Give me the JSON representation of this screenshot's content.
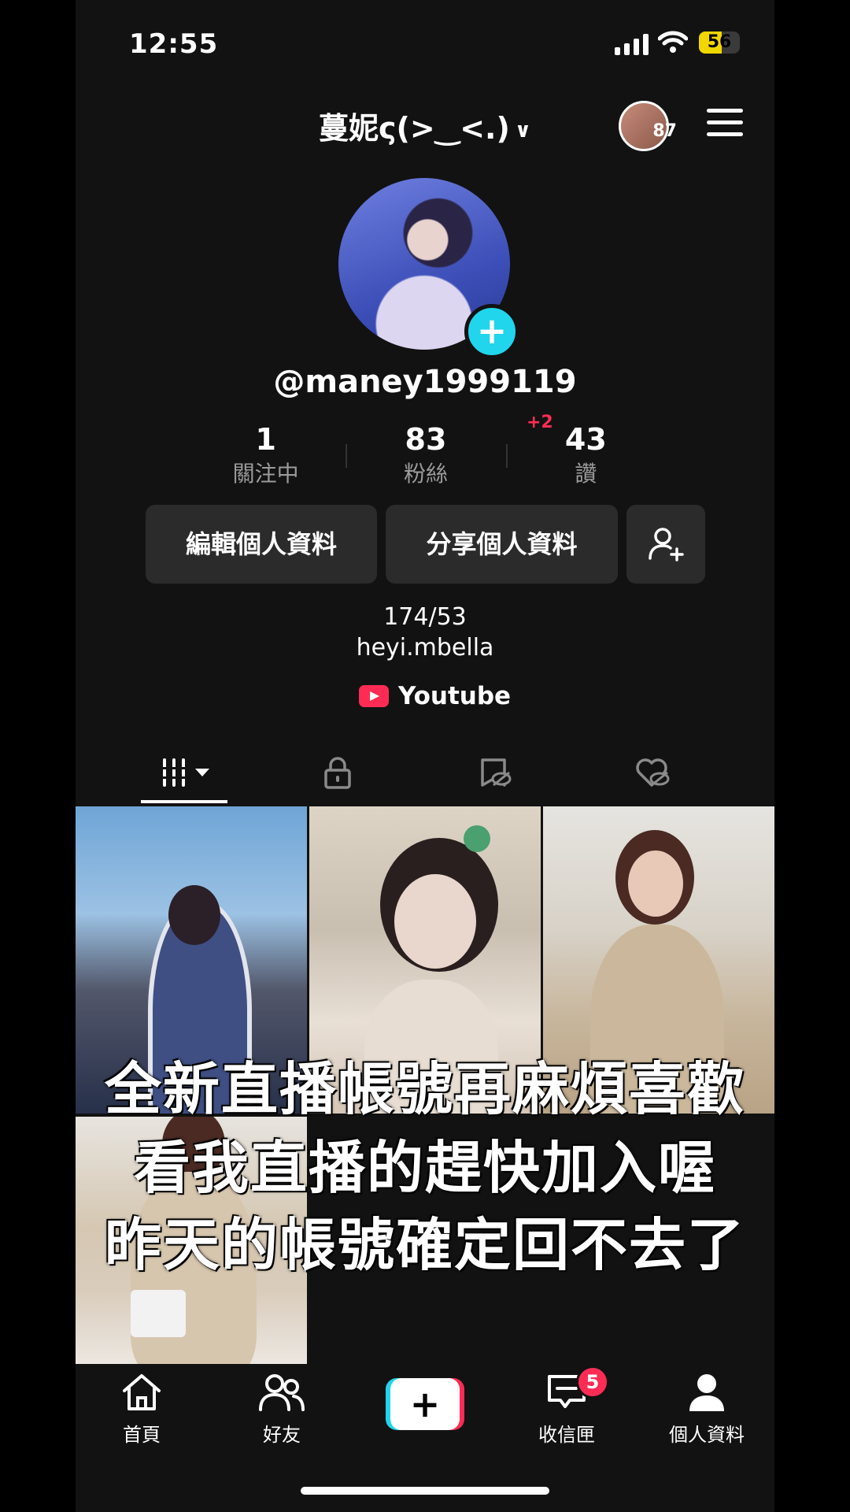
{
  "status": {
    "time": "12:55",
    "battery": "56",
    "battery_level": 0.56
  },
  "header": {
    "title": "蔓妮ς(>‿<.)",
    "story_count": "87"
  },
  "profile": {
    "handle": "@maney1999119",
    "stats": [
      {
        "value": "1",
        "label": "關注中"
      },
      {
        "value": "83",
        "label": "粉絲"
      },
      {
        "value": "43",
        "label": "讚"
      }
    ],
    "followers_delta": "+2",
    "edit_label": "編輯個人資料",
    "share_label": "分享個人資料",
    "bio_line1": "174/53",
    "bio_line2": "heyi.mbella",
    "link_label": "Youtube"
  },
  "overlay_text": {
    "line1": "全新直播帳號再麻煩喜歡",
    "line2": "看我直播的趕快加入喔",
    "line3": "昨天的帳號確定回不去了"
  },
  "nav": {
    "home": "首頁",
    "friends": "好友",
    "inbox": "收信匣",
    "inbox_badge": "5",
    "profile": "個人資料"
  },
  "colors": {
    "accent_red": "#fe2c55",
    "accent_cyan": "#20d5ec",
    "background": "#121212"
  }
}
